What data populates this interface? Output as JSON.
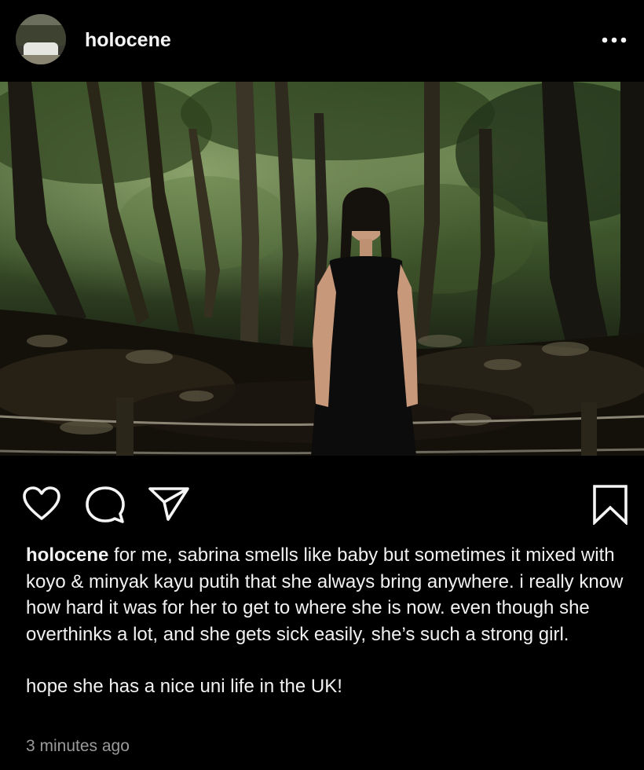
{
  "post": {
    "username": "holocene",
    "caption_paragraphs": [
      "for me, sabrina smells like baby but sometimes it mixed with koyo & minyak kayu putih that she always bring anywhere. i really know how hard it was for her to get to where she is now. even though she overthinks a lot, and she gets sick easily, she’s such a strong girl.",
      "hope she has a nice uni life in the UK!"
    ],
    "timestamp": "3 minutes ago"
  },
  "icons": {
    "avatar": "profile-avatar",
    "more": "more-dots-icon",
    "like": "heart-icon",
    "comment": "comment-bubble-icon",
    "share": "paper-plane-icon",
    "save": "bookmark-icon"
  },
  "colors": {
    "background": "#000000",
    "text": "#f5f5f5",
    "timestamp": "#9a9a9a"
  }
}
